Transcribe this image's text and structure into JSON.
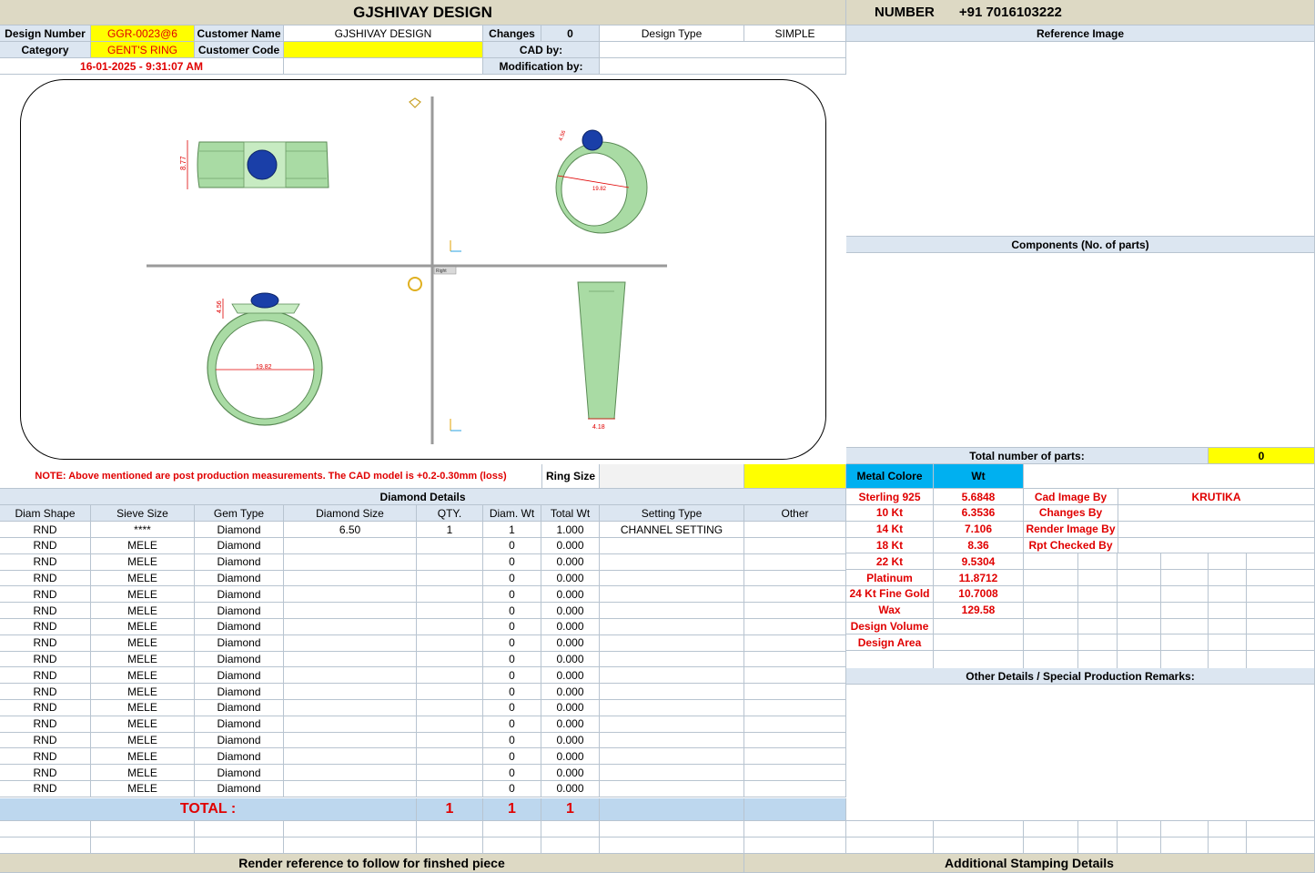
{
  "header": {
    "title": "GJSHIVAY DESIGN",
    "number_label": "NUMBER",
    "number_value": "+91 7016103222"
  },
  "info": {
    "design_number_label": "Design Number",
    "design_number": "GGR-0023@6",
    "customer_name_label": "Customer Name",
    "customer_name": "GJSHIVAY DESIGN",
    "changes_label": "Changes",
    "changes": "0",
    "design_type_label": "Design Type",
    "design_type": "SIMPLE",
    "category_label": "Category",
    "category": "GENT'S RING",
    "customer_code_label": "Customer Code",
    "customer_code": "",
    "cad_by_label": "CAD by:",
    "cad_by": "",
    "timestamp": "16-01-2025 - 9:31:07 AM",
    "modification_by_label": "Modification by:",
    "modification_by": ""
  },
  "reference_image_label": "Reference Image",
  "components_label": "Components (No. of parts)",
  "total_parts_label": "Total number of parts:",
  "total_parts": "0",
  "cad": {
    "dim_top": "8.77",
    "dim_side": "4.56",
    "dim_inner": "19.82",
    "dim_persp": "19.82",
    "dim_front": "4.56",
    "dim_bottom": "4.18",
    "view_label": "Right"
  },
  "colors": {
    "ring": "#a9dba4",
    "stone": "#1a3fa8",
    "dim": "#e00000"
  },
  "note": "NOTE: Above mentioned are post production measurements. The CAD model is +0.2-0.30mm (loss)",
  "ring_size_label": "Ring Size",
  "ring_size": "",
  "metal": {
    "col_label": "Metal Colore",
    "wt_label": "Wt",
    "rows": [
      {
        "name": "Sterling 925",
        "wt": "5.6848",
        "k": "Cad Image By",
        "v": "KRUTIKA"
      },
      {
        "name": "10 Kt",
        "wt": "6.3536",
        "k": "Changes By",
        "v": ""
      },
      {
        "name": "14 Kt",
        "wt": "7.106",
        "k": "Render Image By",
        "v": ""
      },
      {
        "name": "18 Kt",
        "wt": "8.36",
        "k": "Rpt Checked By",
        "v": ""
      },
      {
        "name": "22 Kt",
        "wt": "9.5304"
      },
      {
        "name": "Platinum",
        "wt": "11.8712"
      },
      {
        "name": "24 Kt Fine Gold",
        "wt": "10.7008"
      },
      {
        "name": "Wax",
        "wt": "129.58"
      },
      {
        "name": "Design Volume",
        "wt": ""
      },
      {
        "name": "Design Area",
        "wt": ""
      }
    ]
  },
  "diamond": {
    "title": "Diamond Details",
    "headers": [
      "Diam Shape",
      "Sieve Size",
      "Gem Type",
      "Diamond Size",
      "QTY.",
      "Diam. Wt",
      "Total Wt",
      "Setting Type",
      "Other"
    ],
    "rows": [
      [
        "RND",
        "****",
        "Diamond",
        "6.50",
        "1",
        "1",
        "1.000",
        "CHANNEL SETTING",
        ""
      ],
      [
        "RND",
        "MELE",
        "Diamond",
        "",
        "",
        "0",
        "0.000",
        "",
        ""
      ],
      [
        "RND",
        "MELE",
        "Diamond",
        "",
        "",
        "0",
        "0.000",
        "",
        ""
      ],
      [
        "RND",
        "MELE",
        "Diamond",
        "",
        "",
        "0",
        "0.000",
        "",
        ""
      ],
      [
        "RND",
        "MELE",
        "Diamond",
        "",
        "",
        "0",
        "0.000",
        "",
        ""
      ],
      [
        "RND",
        "MELE",
        "Diamond",
        "",
        "",
        "0",
        "0.000",
        "",
        ""
      ],
      [
        "RND",
        "MELE",
        "Diamond",
        "",
        "",
        "0",
        "0.000",
        "",
        ""
      ],
      [
        "RND",
        "MELE",
        "Diamond",
        "",
        "",
        "0",
        "0.000",
        "",
        ""
      ],
      [
        "RND",
        "MELE",
        "Diamond",
        "",
        "",
        "0",
        "0.000",
        "",
        ""
      ],
      [
        "RND",
        "MELE",
        "Diamond",
        "",
        "",
        "0",
        "0.000",
        "",
        ""
      ],
      [
        "RND",
        "MELE",
        "Diamond",
        "",
        "",
        "0",
        "0.000",
        "",
        ""
      ],
      [
        "RND",
        "MELE",
        "Diamond",
        "",
        "",
        "0",
        "0.000",
        "",
        ""
      ],
      [
        "RND",
        "MELE",
        "Diamond",
        "",
        "",
        "0",
        "0.000",
        "",
        ""
      ],
      [
        "RND",
        "MELE",
        "Diamond",
        "",
        "",
        "0",
        "0.000",
        "",
        ""
      ],
      [
        "RND",
        "MELE",
        "Diamond",
        "",
        "",
        "0",
        "0.000",
        "",
        ""
      ],
      [
        "RND",
        "MELE",
        "Diamond",
        "",
        "",
        "0",
        "0.000",
        "",
        ""
      ],
      [
        "RND",
        "MELE",
        "Diamond",
        "",
        "",
        "0",
        "0.000",
        "",
        ""
      ]
    ],
    "total_label": "TOTAL :",
    "total_qty": "1",
    "total_diam_wt": "1",
    "total_wt": "1"
  },
  "other_details_label": "Other Details / Special Production Remarks:",
  "footer": {
    "render_label": "Render reference to follow for finshed piece",
    "stamping_label": "Additional Stamping Details"
  }
}
